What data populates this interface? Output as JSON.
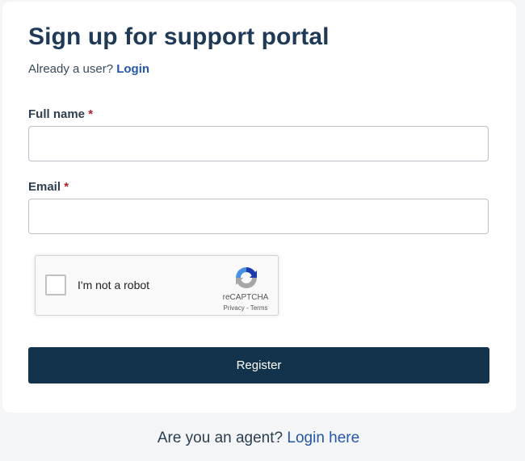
{
  "form": {
    "title": "Sign up for support portal",
    "already_user_text": "Already a user?",
    "login_link": "Login",
    "full_name_label": "Full name",
    "full_name_value": "",
    "email_label": "Email",
    "email_value": "",
    "required_marker": "*",
    "register_button": "Register"
  },
  "captcha": {
    "label": "I'm not a robot",
    "brand": "reCAPTCHA",
    "privacy_link": "Privacy",
    "separator": "-",
    "terms_link": "Terms",
    "logo_icon": "recaptcha-logo-icon"
  },
  "footer": {
    "agent_text": "Are you an agent?",
    "agent_link": "Login here"
  },
  "colors": {
    "title": "#1f3a56",
    "link": "#2457a6",
    "required": "#b11e2f",
    "button_bg": "#13334c",
    "page_bg": "#f3f5f7"
  }
}
